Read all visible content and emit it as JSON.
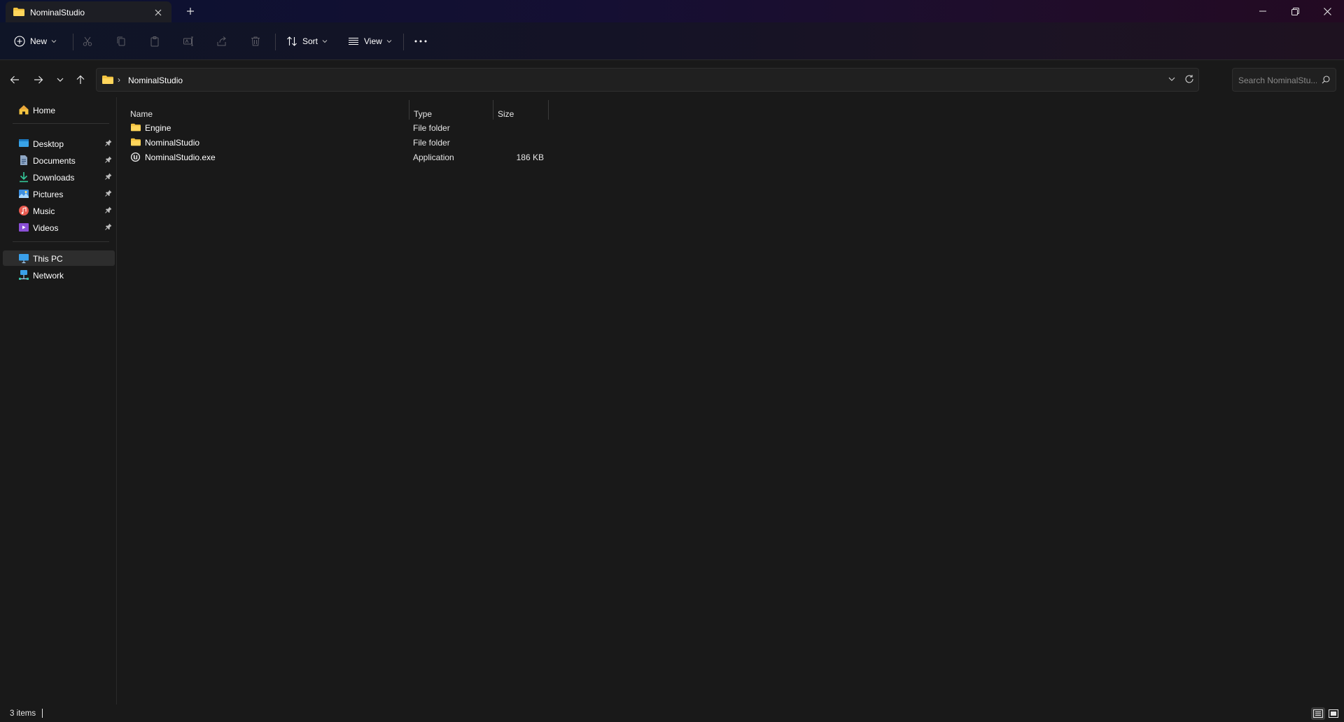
{
  "window": {
    "tab_title": "NominalStudio",
    "new_tab_label": "+"
  },
  "toolbar": {
    "new_label": "New",
    "sort_label": "Sort",
    "view_label": "View",
    "more_label": "⋯",
    "disabled_actions": [
      "cut-icon",
      "copy-icon",
      "paste-icon",
      "rename-icon",
      "share-icon",
      "delete-icon"
    ]
  },
  "address": {
    "separator": "›",
    "breadcrumb": "NominalStudio"
  },
  "search": {
    "placeholder": "Search NominalStu..."
  },
  "sidebar": {
    "home": "Home",
    "quick_access": [
      {
        "label": "Desktop",
        "icon": "desktop-icon",
        "pinned": true
      },
      {
        "label": "Documents",
        "icon": "documents-icon",
        "pinned": true
      },
      {
        "label": "Downloads",
        "icon": "downloads-icon",
        "pinned": true
      },
      {
        "label": "Pictures",
        "icon": "pictures-icon",
        "pinned": true
      },
      {
        "label": "Music",
        "icon": "music-icon",
        "pinned": true
      },
      {
        "label": "Videos",
        "icon": "videos-icon",
        "pinned": true
      }
    ],
    "this_pc": "This PC",
    "network": "Network"
  },
  "columns": {
    "name": "Name",
    "type": "Type",
    "size": "Size"
  },
  "files": [
    {
      "name": "Engine",
      "type": "File folder",
      "size": "",
      "icon": "folder-icon"
    },
    {
      "name": "NominalStudio",
      "type": "File folder",
      "size": "",
      "icon": "folder-icon"
    },
    {
      "name": "NominalStudio.exe",
      "type": "Application",
      "size": "186 KB",
      "icon": "application-icon"
    }
  ],
  "status": {
    "item_count": "3 items"
  },
  "colors": {
    "accent_folder": "#f3c340",
    "background": "#191919",
    "selected": "#2d2d2d"
  }
}
